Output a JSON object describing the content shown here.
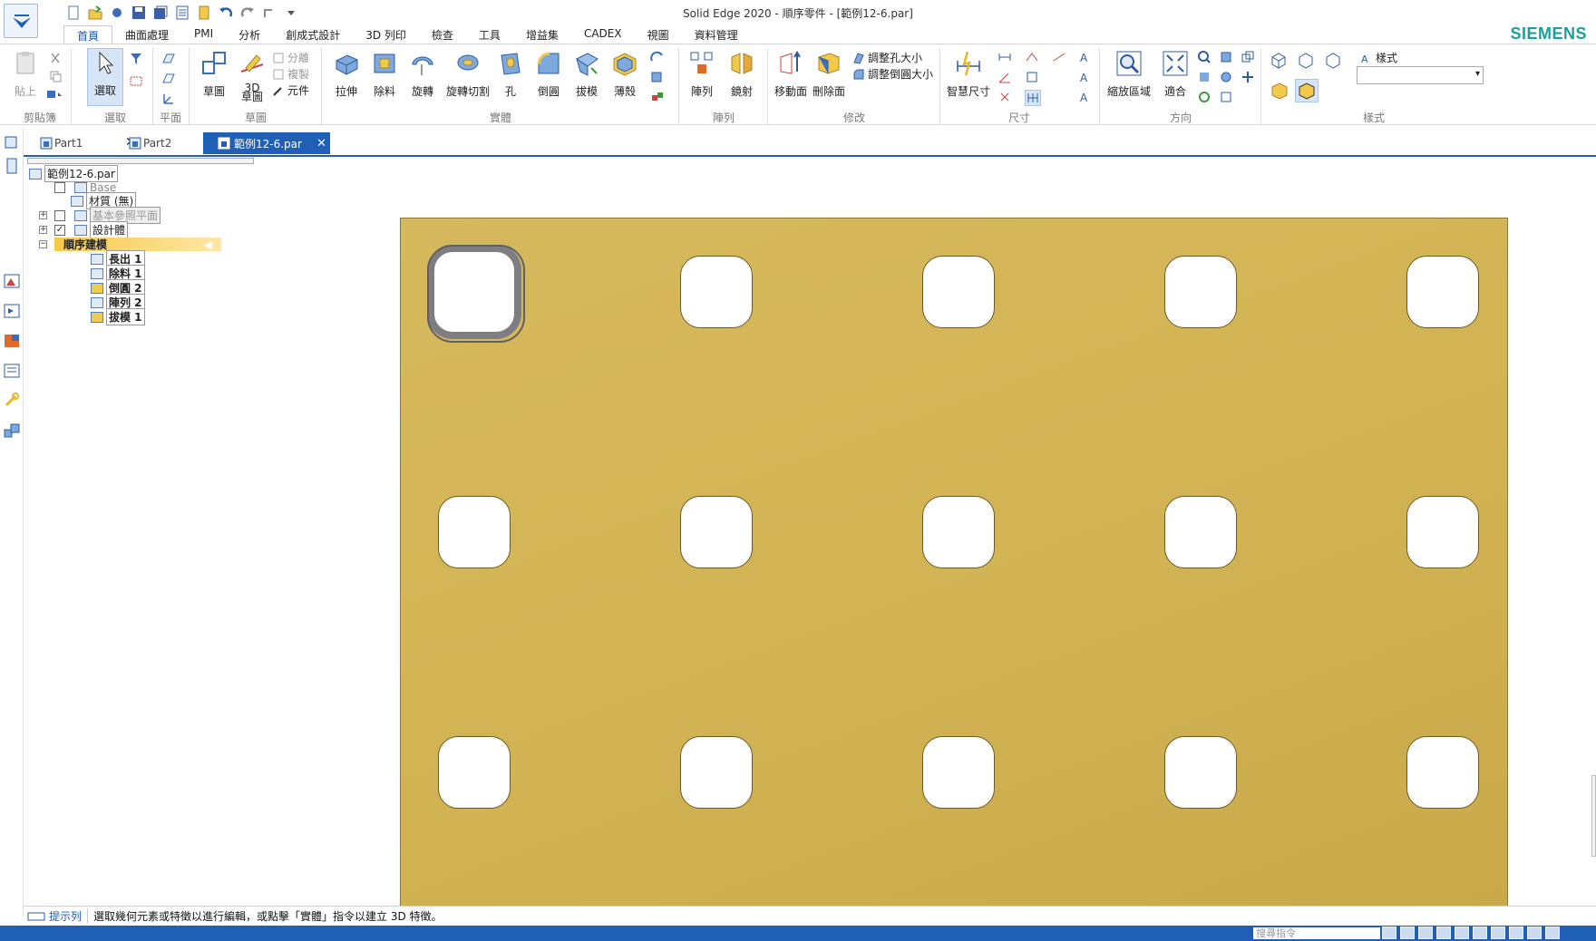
{
  "window": {
    "title": "Solid Edge 2020 - 順序零件 - [範例12-6.par]",
    "brand": "SIEMENS"
  },
  "ribbon_tabs": [
    "首頁",
    "曲面處理",
    "PMI",
    "分析",
    "創成式設計",
    "3D 列印",
    "檢查",
    "工具",
    "增益集",
    "CADEX",
    "視圖",
    "資料管理"
  ],
  "ribbon": {
    "clipboard": {
      "paste": "貼上",
      "group": "剪貼簿"
    },
    "select": {
      "select": "選取",
      "group": "選取"
    },
    "plane": {
      "group": "平面"
    },
    "sketch": {
      "sketch": "草圖",
      "sketch3d": "3D\n草圖",
      "split": "分離",
      "copy": "複製",
      "part": "元件",
      "group": "草圖"
    },
    "solid": {
      "extrude": "拉伸",
      "cutout": "除料",
      "revolve": "旋轉",
      "revolve_cut": "旋轉切割",
      "hole": "孔",
      "round": "倒圓",
      "draft": "拔模",
      "thin": "薄殼",
      "group": "實體"
    },
    "pattern": {
      "pattern": "陣列",
      "mirror": "鏡射",
      "group": "陣列"
    },
    "modify": {
      "move_face": "移動面",
      "delete_face": "刪除面",
      "resize_hole": "調整孔大小",
      "resize_round": "調整倒圓大小",
      "group": "修改"
    },
    "dimension": {
      "smart": "智慧尺寸",
      "group": "尺寸"
    },
    "orient": {
      "zoom_area": "縮放區域",
      "fit": "適合",
      "group": "方向"
    },
    "style": {
      "style_label": "樣式",
      "group": "樣式"
    }
  },
  "doc_tabs": [
    {
      "label": "Part1",
      "active": false
    },
    {
      "label": "Part2",
      "active": false
    },
    {
      "label": "範例12-6.par",
      "active": true
    }
  ],
  "tree": {
    "root": "範例12-6.par",
    "base": "Base",
    "material": "材質 (無)",
    "ref_planes": "基本參照平面",
    "design_body": "設計體",
    "ordered": "順序建模",
    "features": [
      "長出 1",
      "除料 1",
      "倒圓 2",
      "陣列 2",
      "拔模 1"
    ]
  },
  "holes": {
    "rows": 3,
    "cols": 5,
    "selected": [
      0,
      0
    ]
  },
  "prompt": {
    "label": "提示列",
    "text": "選取幾何元素或特徵以進行編輯，或點擊「實體」指令以建立 3D 特徵。"
  },
  "status": {
    "search_placeholder": "搜尋指令"
  },
  "colors": {
    "accent": "#1f5fb5",
    "part_face": "#d4b657",
    "brand": "#1aa09b"
  }
}
